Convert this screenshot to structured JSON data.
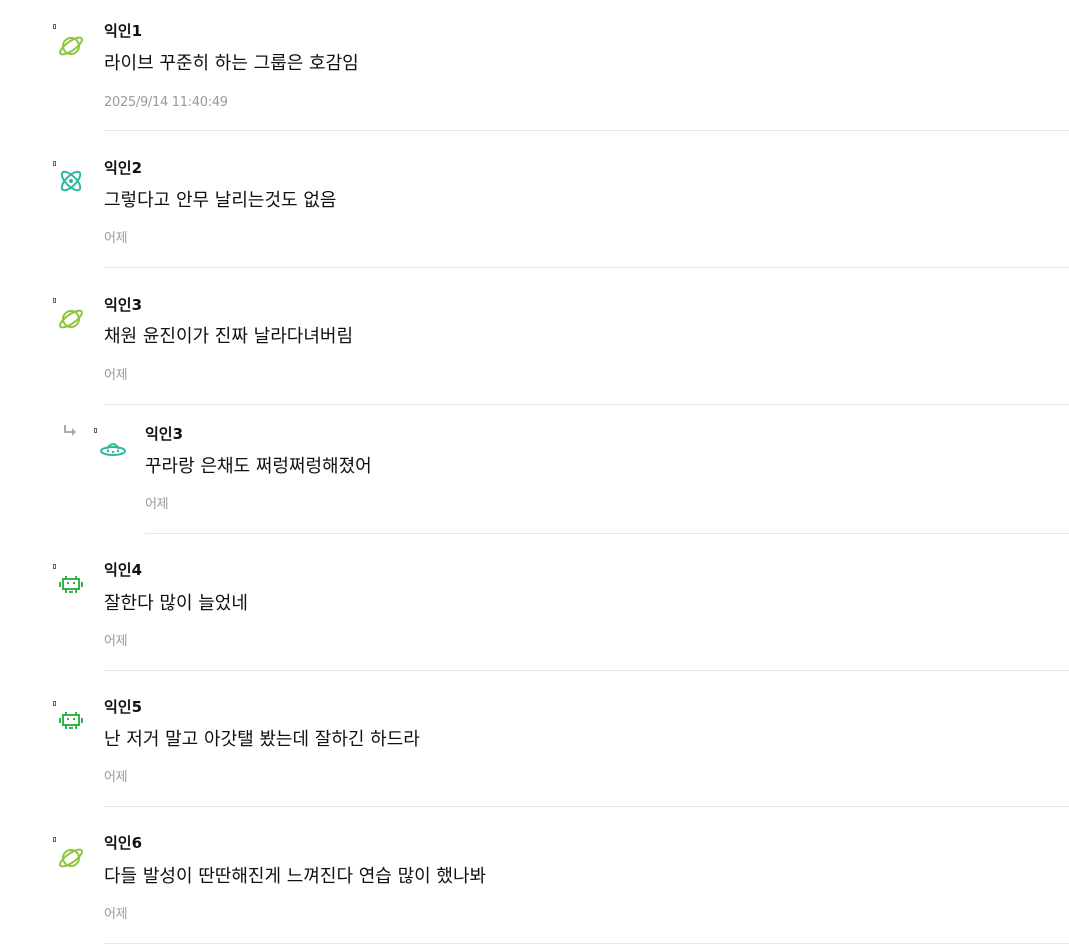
{
  "comments": [
    {
      "author": "익인1",
      "text": "라이브 꾸준히 하는 그룹은 호감임",
      "time": "2025/9/14 11:40:49",
      "avatar_icon": "planet-icon",
      "avatar_color": "#8cc63f"
    },
    {
      "author": "익인2",
      "text": "그렇다고 안무 날리는것도 없음",
      "time": "어제",
      "avatar_icon": "atom-icon",
      "avatar_color": "#2bb8a0"
    },
    {
      "author": "익인3",
      "text": "채원 윤진이가 진짜 날라다녀버림",
      "time": "어제",
      "avatar_icon": "planet-icon",
      "avatar_color": "#8cc63f"
    },
    {
      "author": "익인3",
      "text": "꾸라랑 은채도 쩌렁쩌렁해졌어",
      "time": "어제",
      "avatar_icon": "ufo-icon",
      "avatar_color": "#2bb89a",
      "is_reply": true,
      "reply_icon": "reply-arrow-icon"
    },
    {
      "author": "익인4",
      "text": "잘한다 많이 늘었네",
      "time": "어제",
      "avatar_icon": "space-invader-icon",
      "avatar_color": "#33b34a"
    },
    {
      "author": "익인5",
      "text": "난 저거 말고 아갓탤 봤는데 잘하긴 하드라",
      "time": "어제",
      "avatar_icon": "space-invader-icon",
      "avatar_color": "#33b34a"
    },
    {
      "author": "익인6",
      "text": "다들 발성이 딴딴해진게 느껴진다 연습 많이 했나봐",
      "time": "어제",
      "avatar_icon": "planet-icon",
      "avatar_color": "#8cc63f"
    }
  ]
}
